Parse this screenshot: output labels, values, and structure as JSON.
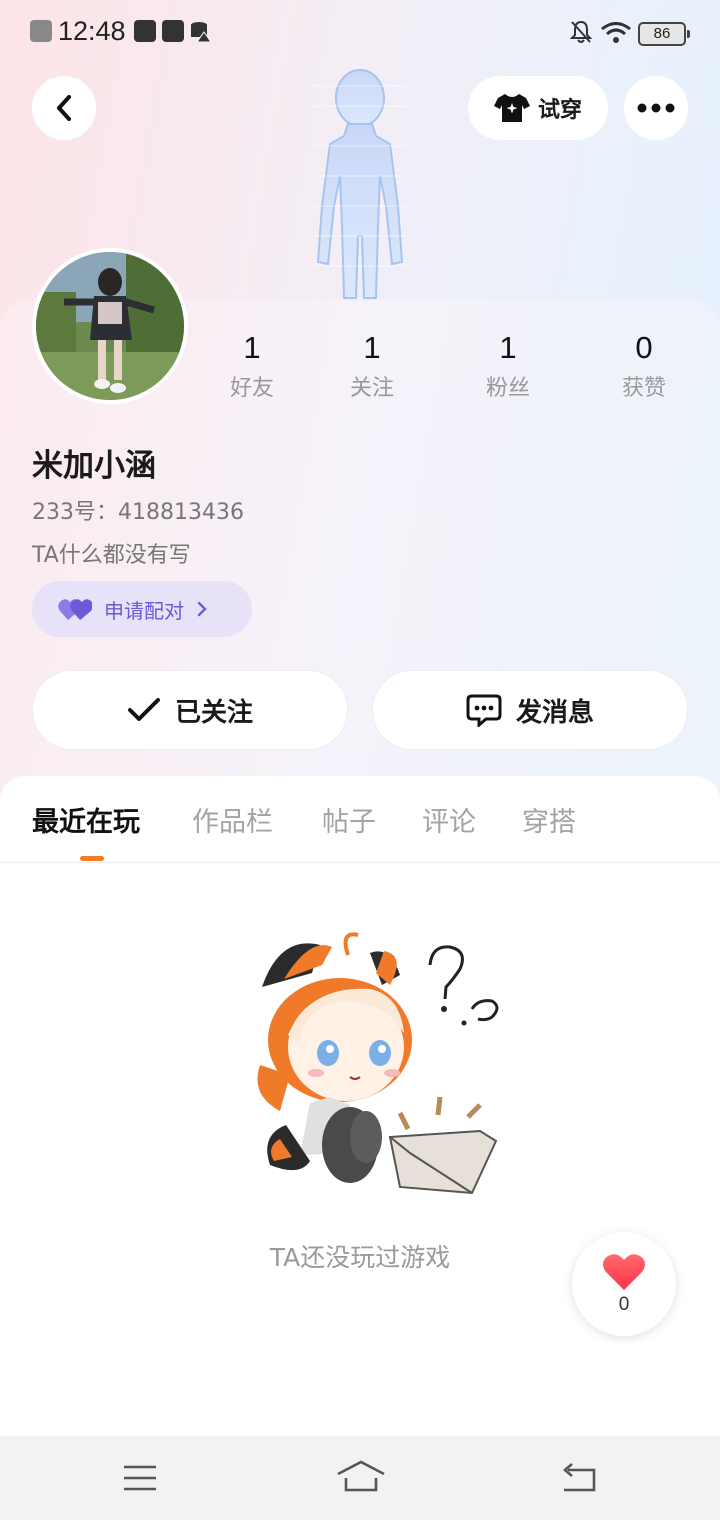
{
  "status_bar": {
    "time": "12:48",
    "battery": "86"
  },
  "header": {
    "tryon_label": "试穿"
  },
  "profile": {
    "name": "米加小涵",
    "id_line": "233号：418813436",
    "bio": "TA什么都没有写",
    "pair_label": "申请配对",
    "stats": [
      {
        "value": "1",
        "label": "好友"
      },
      {
        "value": "1",
        "label": "关注"
      },
      {
        "value": "1",
        "label": "粉丝"
      },
      {
        "value": "0",
        "label": "获赞"
      }
    ],
    "follow_label": "已关注",
    "message_label": "发消息"
  },
  "tabs": [
    "最近在玩",
    "作品栏",
    "帖子",
    "评论",
    "穿搭"
  ],
  "active_tab": "最近在玩",
  "empty_text": "TA还没玩过游戏",
  "like_count": "0",
  "colors": {
    "accent": "#f47b20",
    "pair_bg": "#e8e2f8",
    "pair_text": "#6c5ad6",
    "like": "#ff4d5a"
  }
}
